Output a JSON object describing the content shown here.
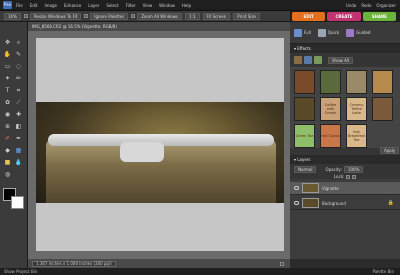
{
  "menu": {
    "items": [
      "File",
      "Edit",
      "Image",
      "Enhance",
      "Layer",
      "Select",
      "Filter",
      "View",
      "Window",
      "Help"
    ],
    "right": [
      "Undo",
      "Redo",
      "Organizer"
    ]
  },
  "options": {
    "zoom": "16%",
    "resize": "Resize Windows To Fit",
    "ignore": "Ignore Palettes",
    "zoom_all": "Zoom All Windows",
    "one": "1:1",
    "fit": "Fit Screen",
    "print": "Print Size"
  },
  "mode_tabs": [
    {
      "label": "EDIT",
      "color": "#e36f1f"
    },
    {
      "label": "CREATE",
      "color": "#c0346f"
    },
    {
      "label": "SHARE",
      "color": "#6bb33b"
    }
  ],
  "quick": [
    {
      "label": "Full"
    },
    {
      "label": "Quick"
    },
    {
      "label": "Guided"
    }
  ],
  "document": {
    "title": "IMG_8566.CR2 @ 16.5% (Vignette, RGB/8)",
    "status": "1.367 inches x 1.000 inches (300 ppi)"
  },
  "effects": {
    "title": "Effects",
    "show": "Show All",
    "apply": "Apply",
    "thumbs": [
      {
        "text": "",
        "bg": "#7a4b2a"
      },
      {
        "text": "",
        "bg": "#5a6a3a"
      },
      {
        "text": "",
        "bg": "#9a8a6a"
      },
      {
        "text": "",
        "bg": "#b58a4a"
      },
      {
        "text": "",
        "bg": "#5a4a2a"
      },
      {
        "text": "Coffee with Cream",
        "bg": "#c9a27a"
      },
      {
        "text": "Creamy Toffee Latte",
        "bg": "#d7b98a"
      },
      {
        "text": "",
        "bg": "#7a5a3a"
      },
      {
        "text": "Green Tea",
        "bg": "#8fbf6a"
      },
      {
        "text": "Hot Cocoa",
        "bg": "#c8774a"
      },
      {
        "text": "Irish Breakfast Tea",
        "bg": "#d9b98a"
      }
    ]
  },
  "layers": {
    "title": "Layers",
    "blend": "Normal",
    "opacity_label": "Opacity:",
    "opacity": "100%",
    "lock": "Lock:",
    "items": [
      {
        "name": "Vignette",
        "selected": true
      },
      {
        "name": "Background",
        "selected": false
      }
    ]
  },
  "bottom": {
    "left": "Show Project Bin",
    "right": "Palette Bin"
  }
}
